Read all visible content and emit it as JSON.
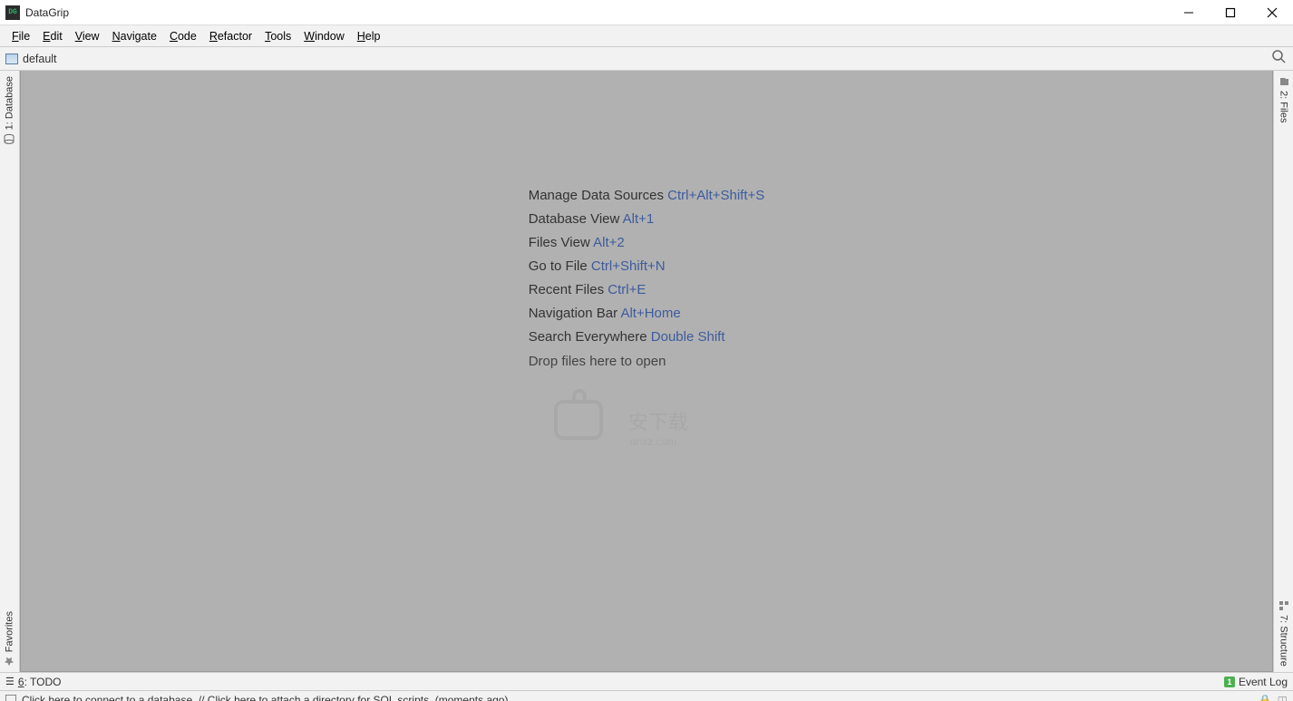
{
  "app": {
    "title": "DataGrip",
    "icon_text": "DG"
  },
  "menu": [
    "File",
    "Edit",
    "View",
    "Navigate",
    "Code",
    "Refactor",
    "Tools",
    "Window",
    "Help"
  ],
  "nav": {
    "folder": "default"
  },
  "left_tabs": {
    "database": "1: Database",
    "favorites": "Favorites"
  },
  "right_tabs": {
    "files": "2: Files",
    "structure": "7: Structure"
  },
  "welcome": [
    {
      "label": "Manage Data Sources",
      "shortcut": "Ctrl+Alt+Shift+S"
    },
    {
      "label": "Database View",
      "shortcut": "Alt+1"
    },
    {
      "label": "Files View",
      "shortcut": "Alt+2"
    },
    {
      "label": "Go to File",
      "shortcut": "Ctrl+Shift+N"
    },
    {
      "label": "Recent Files",
      "shortcut": "Ctrl+E"
    },
    {
      "label": "Navigation Bar",
      "shortcut": "Alt+Home"
    },
    {
      "label": "Search Everywhere",
      "shortcut": "Double Shift"
    }
  ],
  "drop_text": "Drop files here to open",
  "bottom": {
    "todo": "6: TODO",
    "event_log": "Event Log"
  },
  "status": {
    "message": "Click here to connect to a database. // Click here to attach a directory for SQL scripts. (moments ago)"
  }
}
